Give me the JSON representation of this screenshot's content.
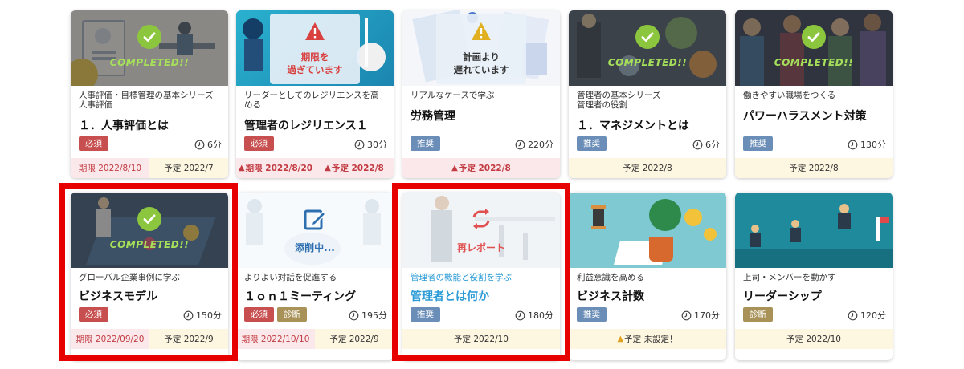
{
  "accent_colors": {
    "required": "#c84f4f",
    "recommended": "#6b8eb8",
    "diagnosis": "#a89257",
    "completed_check": "#8cc63f",
    "highlight": "#e60000",
    "link_blue": "#2b9bd6"
  },
  "cards": [
    {
      "status": "COMPLETED!!",
      "series": "人事評価・目標管理の基本シリーズ\n人事評価",
      "title": "１．人事評価とは",
      "badges": [
        "必須"
      ],
      "time": "6分",
      "footer": [
        {
          "text": "期限 2022/8/10",
          "style": "red"
        },
        {
          "text": "予定 2022/7",
          "style": "yellow"
        }
      ]
    },
    {
      "status": "期限を\n過ぎています",
      "series": "リーダーとしてのレジリエンスを高\nめる",
      "title": "管理者のレジリエンス１",
      "badges": [
        "必須"
      ],
      "time": "30分",
      "footer": [
        {
          "text": "期限 2022/8/20",
          "style": "red",
          "warn": true
        },
        {
          "text": "予定 2022/8",
          "style": "red",
          "warn": true
        }
      ]
    },
    {
      "status": "計画より\n遅れています",
      "series": "リアルなケースで学ぶ",
      "title": "労務管理",
      "badges": [
        "推奨"
      ],
      "time": "220分",
      "footer": [
        {
          "text": "予定 2022/8",
          "style": "red",
          "warn": true
        }
      ]
    },
    {
      "status": "COMPLETED!!",
      "series": "管理者の基本シリーズ\n管理者の役割",
      "title": "１．マネジメントとは",
      "badges": [
        "推奨"
      ],
      "time": "6分",
      "footer": [
        {
          "text": "予定 2022/8",
          "style": "yellow"
        }
      ]
    },
    {
      "status": "COMPLETED!!",
      "series": "働きやすい職場をつくる",
      "title": "パワーハラスメント対策",
      "badges": [
        "推奨"
      ],
      "time": "130分",
      "footer": [
        {
          "text": "予定 2022/8",
          "style": "yellow"
        }
      ]
    },
    {
      "status": "COMPLETED!!",
      "series": "グローバル企業事例に学ぶ",
      "title": "ビジネスモデル",
      "badges": [
        "必須"
      ],
      "time": "150分",
      "footer": [
        {
          "text": "期限 2022/09/20",
          "style": "red"
        },
        {
          "text": "予定 2022/9",
          "style": "yellow"
        }
      ]
    },
    {
      "status": "添削中...",
      "series": "よりよい対話を促進する",
      "title": "１ｏｎ１ミーティング",
      "badges": [
        "必須",
        "診断"
      ],
      "time": "195分",
      "footer": [
        {
          "text": "期限 2022/10/10",
          "style": "red"
        },
        {
          "text": "予定 2022/9",
          "style": "yellow"
        }
      ]
    },
    {
      "status": "再レポート",
      "series": "管理者の機能と役割を学ぶ",
      "title": "管理者とは何か",
      "badges": [
        "推奨"
      ],
      "time": "180分",
      "footer": [
        {
          "text": "予定 2022/10",
          "style": "yellow"
        }
      ]
    },
    {
      "status": "",
      "series": "利益意識を高める",
      "title": "ビジネス計数",
      "badges": [
        "推奨"
      ],
      "time": "170分",
      "footer": [
        {
          "text": "予定 未設定！",
          "style": "yellow",
          "warn": true
        }
      ]
    },
    {
      "status": "",
      "series": "上司・メンバーを動かす",
      "title": "リーダーシップ",
      "badges": [
        "診断"
      ],
      "time": "120分",
      "footer": [
        {
          "text": "予定 2022/10",
          "style": "yellow"
        }
      ]
    }
  ]
}
